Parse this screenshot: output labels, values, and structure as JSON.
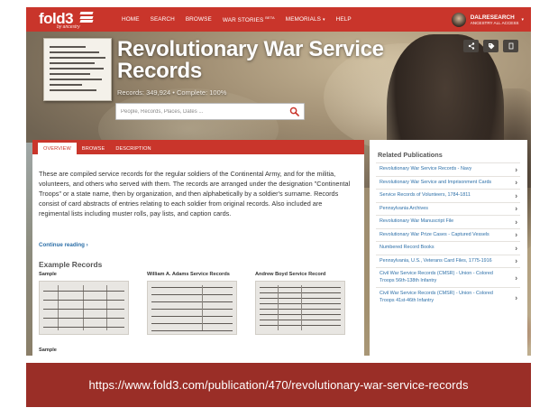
{
  "brand": {
    "logo_text": "fold3",
    "logo_sub": "by ancestry"
  },
  "nav": {
    "items": [
      "HOME",
      "SEARCH",
      "BROWSE",
      "WAR STORIES",
      "MEMORIALS",
      "HELP"
    ],
    "war_stories_badge": "BETA"
  },
  "user": {
    "name": "DALRESEARCH",
    "plan": "ANCESTRY ALL ACCESS"
  },
  "hero": {
    "title": "Revolutionary War Service Records",
    "stats": "Records: 349,924 • Complete: 100%",
    "search_placeholder": "People, Records, Places, Dates ...",
    "actions": [
      "share-icon",
      "tag-icon",
      "bookmark-icon"
    ]
  },
  "tabs": [
    "OVERVIEW",
    "BROWSE",
    "DESCRIPTION"
  ],
  "overview": {
    "description": "These are compiled service records for the regular soldiers of the Continental Army, and for the militia, volunteers, and others who served with them. The records are arranged under the designation \"Continental Troops\" or a state name, then by organization, and then alphabetically by a soldier's surname. Records consist of card abstracts of entries relating to each soldier from original records. Also included are regimental lists including muster rolls, pay lists, and caption cards.",
    "continue_label": "Continue reading ›",
    "examples_title": "Example Records",
    "examples": [
      {
        "label": "Sample"
      },
      {
        "label": "William A. Adams Service Records"
      },
      {
        "label": "Andrew Boyd Service Record"
      }
    ],
    "sample2_label": "Sample"
  },
  "sidebar": {
    "title": "Related Publications",
    "items": [
      "Revolutionary War Service Records - Navy",
      "Revolutionary War Service and Imprisonment Cards",
      "Service Records of Volunteers, 1784-1811",
      "Pennsylvania Archives",
      "Revolutionary War Manuscript File",
      "Revolutionary War Prize Cases - Captured Vessels",
      "Numbered Record Books",
      "Pennsylvania, U.S., Veterans Card Files, 1775-1916",
      "Civil War Service Records (CMSR) - Union - Colored Troops 56th-138th Infantry",
      "Civil War Service Records (CMSR) - Union - Colored Troops 41st-46th Infantry"
    ]
  },
  "caption": {
    "url": "https://www.fold3.com/publication/470/revolutionary-war-service-records"
  },
  "colors": {
    "brand_red": "#c9352b",
    "caption_red": "#9a2e27",
    "link_blue": "#2c6fa8"
  }
}
